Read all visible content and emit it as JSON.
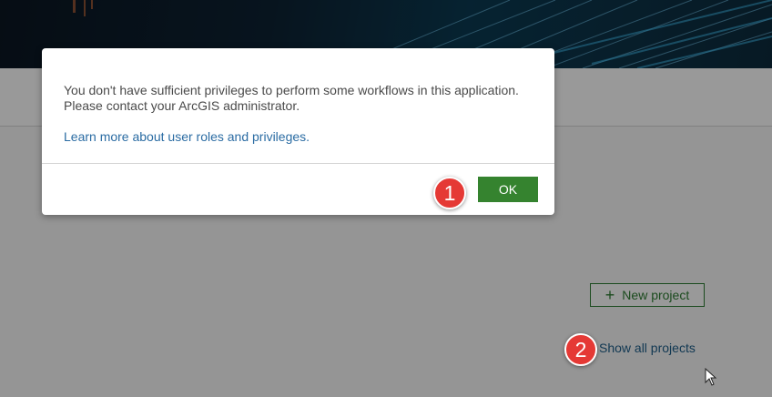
{
  "dialog": {
    "message": "You don't have sufficient privileges to perform some workflows in this application. Please contact your ArcGIS administrator.",
    "link_text": "Learn more about user roles and privileges.",
    "ok_label": "OK"
  },
  "main": {
    "new_project_label": "New project",
    "show_all_projects_label": "Show all projects"
  },
  "annotations": {
    "step1": "1",
    "step2": "2"
  },
  "colors": {
    "accent_green": "#35832f",
    "link_blue": "#2b6ca3",
    "badge_red": "#e53935"
  },
  "icons": {
    "plus": "plus-icon",
    "cursor": "mouse-pointer-icon"
  }
}
